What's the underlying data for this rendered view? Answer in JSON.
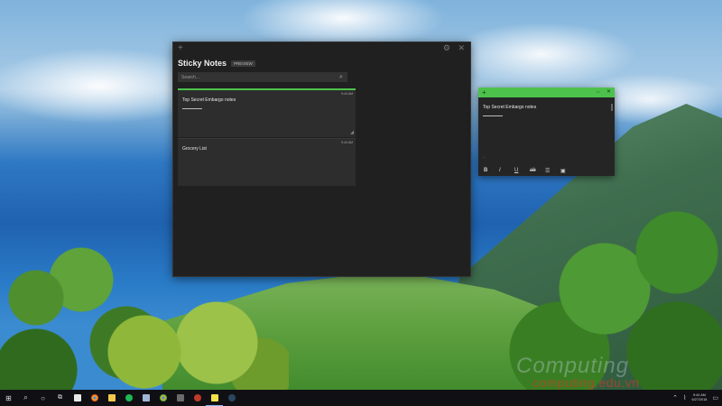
{
  "desktop": {
    "watermark_line1": "Computing",
    "watermark_line2": "computing.edu.vn"
  },
  "sticky_notes": {
    "title": "Sticky Notes",
    "badge": "PREVIEW",
    "search_placeholder": "Search...",
    "notes": [
      {
        "text": "Top Secret Embargo notes",
        "date": "9:44 AM",
        "accent": "#4cc24c"
      },
      {
        "text": "Grocery List",
        "date": "9:44 AM"
      }
    ]
  },
  "floating_note": {
    "text": "Top Secret Embargo notes",
    "ellipsis": "...",
    "accent": "#4cc24c",
    "toolbar": [
      "B",
      "I",
      "U",
      "ab",
      "☰",
      "▣"
    ]
  },
  "taskbar": {
    "clock_time": "9:44 AM",
    "clock_date": "6/27/2018"
  }
}
